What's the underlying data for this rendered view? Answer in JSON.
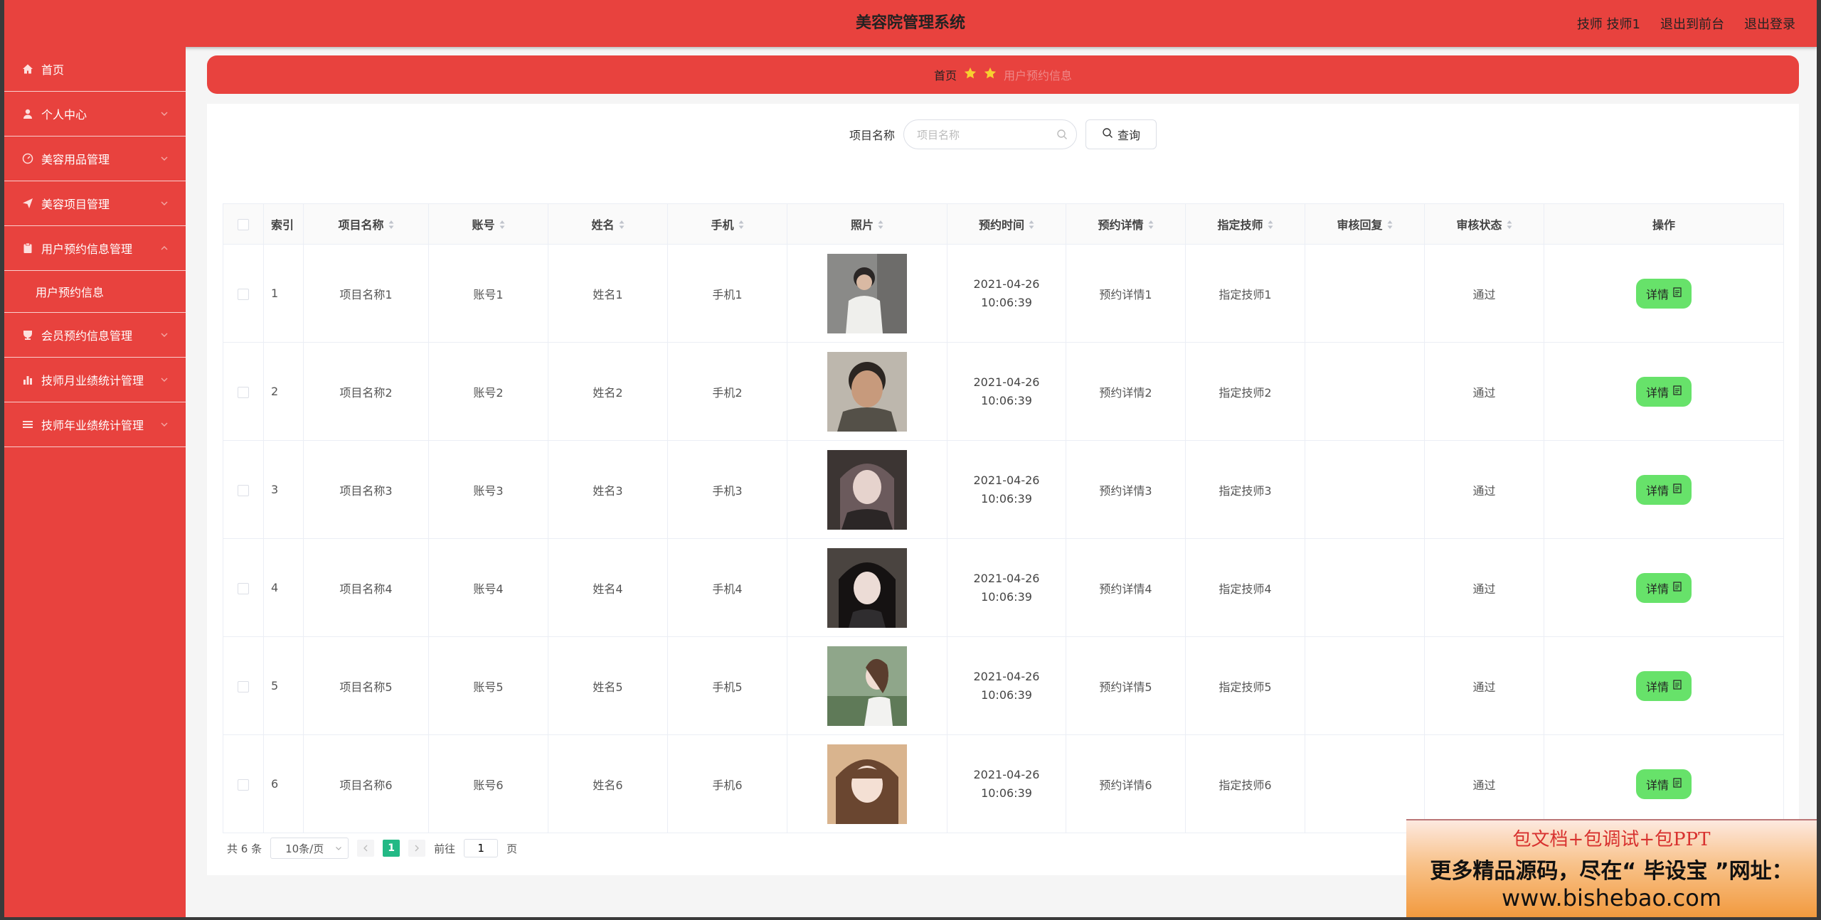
{
  "header": {
    "title": "美容院管理系统",
    "user": "技师 技师1",
    "back_label": "退出到前台",
    "logout_label": "退出登录"
  },
  "sidebar": {
    "items": [
      {
        "label": "首页",
        "icon": "home-icon"
      },
      {
        "label": "个人中心",
        "icon": "user-icon"
      },
      {
        "label": "美容用品管理",
        "icon": "gauge-icon"
      },
      {
        "label": "美容项目管理",
        "icon": "send-icon"
      },
      {
        "label": "用户预约信息管理",
        "icon": "clipboard-icon",
        "expanded": true,
        "sub": "用户预约信息"
      },
      {
        "label": "会员预约信息管理",
        "icon": "cup-icon"
      },
      {
        "label": "技师月业绩统计管理",
        "icon": "bar-chart-icon"
      },
      {
        "label": "技师年业绩统计管理",
        "icon": "list-icon"
      }
    ]
  },
  "breadcrumb": {
    "home": "首页",
    "current": "用户预约信息"
  },
  "search": {
    "label": "项目名称",
    "placeholder": "项目名称",
    "value": "",
    "button": "查询"
  },
  "table": {
    "columns": [
      "索引",
      "项目名称",
      "账号",
      "姓名",
      "手机",
      "照片",
      "预约时间",
      "预约详情",
      "指定技师",
      "审核回复",
      "审核状态",
      "操作"
    ],
    "rows": [
      {
        "idx": "1",
        "name": "项目名称1",
        "account": "账号1",
        "person": "姓名1",
        "phone": "手机1",
        "time": "2021-04-26 10:06:39",
        "detail": "预约详情1",
        "tech": "指定技师1",
        "reply": "",
        "status": "通过"
      },
      {
        "idx": "2",
        "name": "项目名称2",
        "account": "账号2",
        "person": "姓名2",
        "phone": "手机2",
        "time": "2021-04-26 10:06:39",
        "detail": "预约详情2",
        "tech": "指定技师2",
        "reply": "",
        "status": "通过"
      },
      {
        "idx": "3",
        "name": "项目名称3",
        "account": "账号3",
        "person": "姓名3",
        "phone": "手机3",
        "time": "2021-04-26 10:06:39",
        "detail": "预约详情3",
        "tech": "指定技师3",
        "reply": "",
        "status": "通过"
      },
      {
        "idx": "4",
        "name": "项目名称4",
        "account": "账号4",
        "person": "姓名4",
        "phone": "手机4",
        "time": "2021-04-26 10:06:39",
        "detail": "预约详情4",
        "tech": "指定技师4",
        "reply": "",
        "status": "通过"
      },
      {
        "idx": "5",
        "name": "项目名称5",
        "account": "账号5",
        "person": "姓名5",
        "phone": "手机5",
        "time": "2021-04-26 10:06:39",
        "detail": "预约详情5",
        "tech": "指定技师5",
        "reply": "",
        "status": "通过"
      },
      {
        "idx": "6",
        "name": "项目名称6",
        "account": "账号6",
        "person": "姓名6",
        "phone": "手机6",
        "time": "2021-04-26 10:06:39",
        "detail": "预约详情6",
        "tech": "指定技师6",
        "reply": "",
        "status": "通过"
      }
    ],
    "action_label": "详情"
  },
  "pager": {
    "total": "共 6 条",
    "page_size": "10条/页",
    "current_page": "1",
    "goto_label": "前往",
    "goto_value": "1",
    "page_suffix": "页"
  },
  "banner": {
    "line1": "包文档+包调试+包PPT",
    "line2": "更多精品源码，尽在“ 毕设宝 ”网址：",
    "line3": "www.bishebao.com"
  },
  "colors": {
    "primary": "#e8423e",
    "detail_button": "#67e26a",
    "page_active": "#23b985"
  }
}
